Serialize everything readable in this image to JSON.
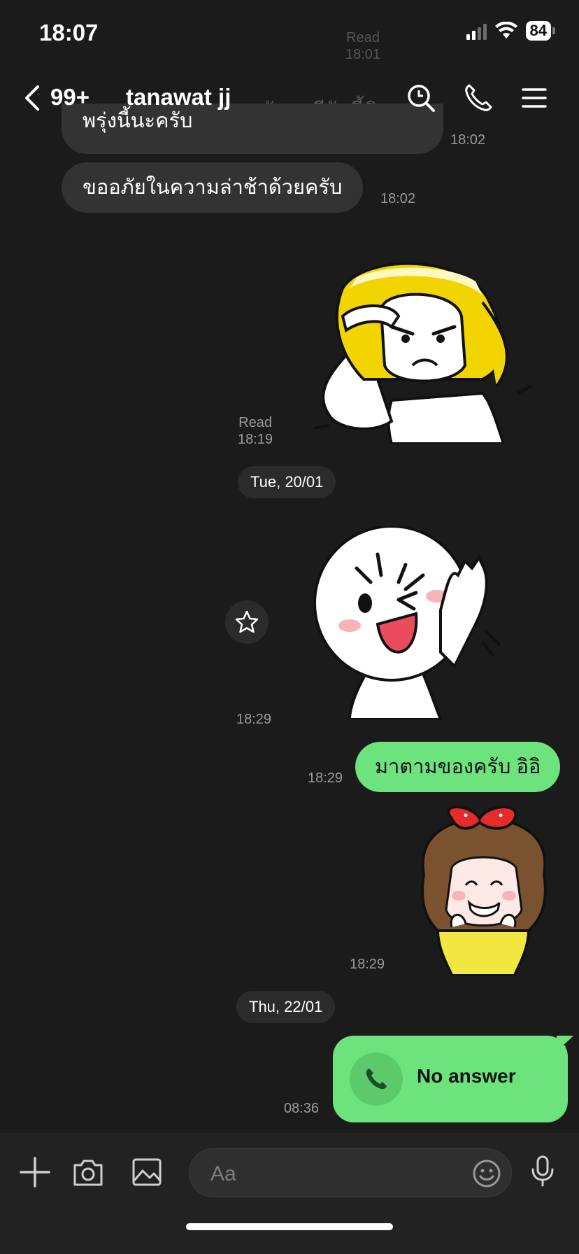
{
  "status_bar": {
    "time": "18:07",
    "battery": "84"
  },
  "header": {
    "unread": "99+",
    "title": "tanawat jj"
  },
  "background_meta": {
    "read_label": "Read",
    "read_time": "18:01",
    "partial_text": "ครับพอดีวันนี้ติดธุ"
  },
  "messages": {
    "incoming_1_text": "พรุ่งนี้นะครับ",
    "incoming_1_time": "18:02",
    "incoming_2_text": "ขออภัยในความล่าช้าด้วยครับ",
    "incoming_2_time": "18:02",
    "sticker_1_read": "Read",
    "sticker_1_time": "18:19",
    "date_1": "Tue, 20/01",
    "sticker_2_time": "18:29",
    "outgoing_1_text": "มาตามของครับ อิอิ",
    "outgoing_1_time": "18:29",
    "sticker_3_time": "18:29",
    "date_2": "Thu, 22/01",
    "call_label": "No answer",
    "call_time": "08:36"
  },
  "input": {
    "placeholder": "Aa"
  },
  "colors": {
    "background": "#1b1b1b",
    "outgoing_bubble": "#6de37d",
    "incoming_bubble": "#333333"
  }
}
